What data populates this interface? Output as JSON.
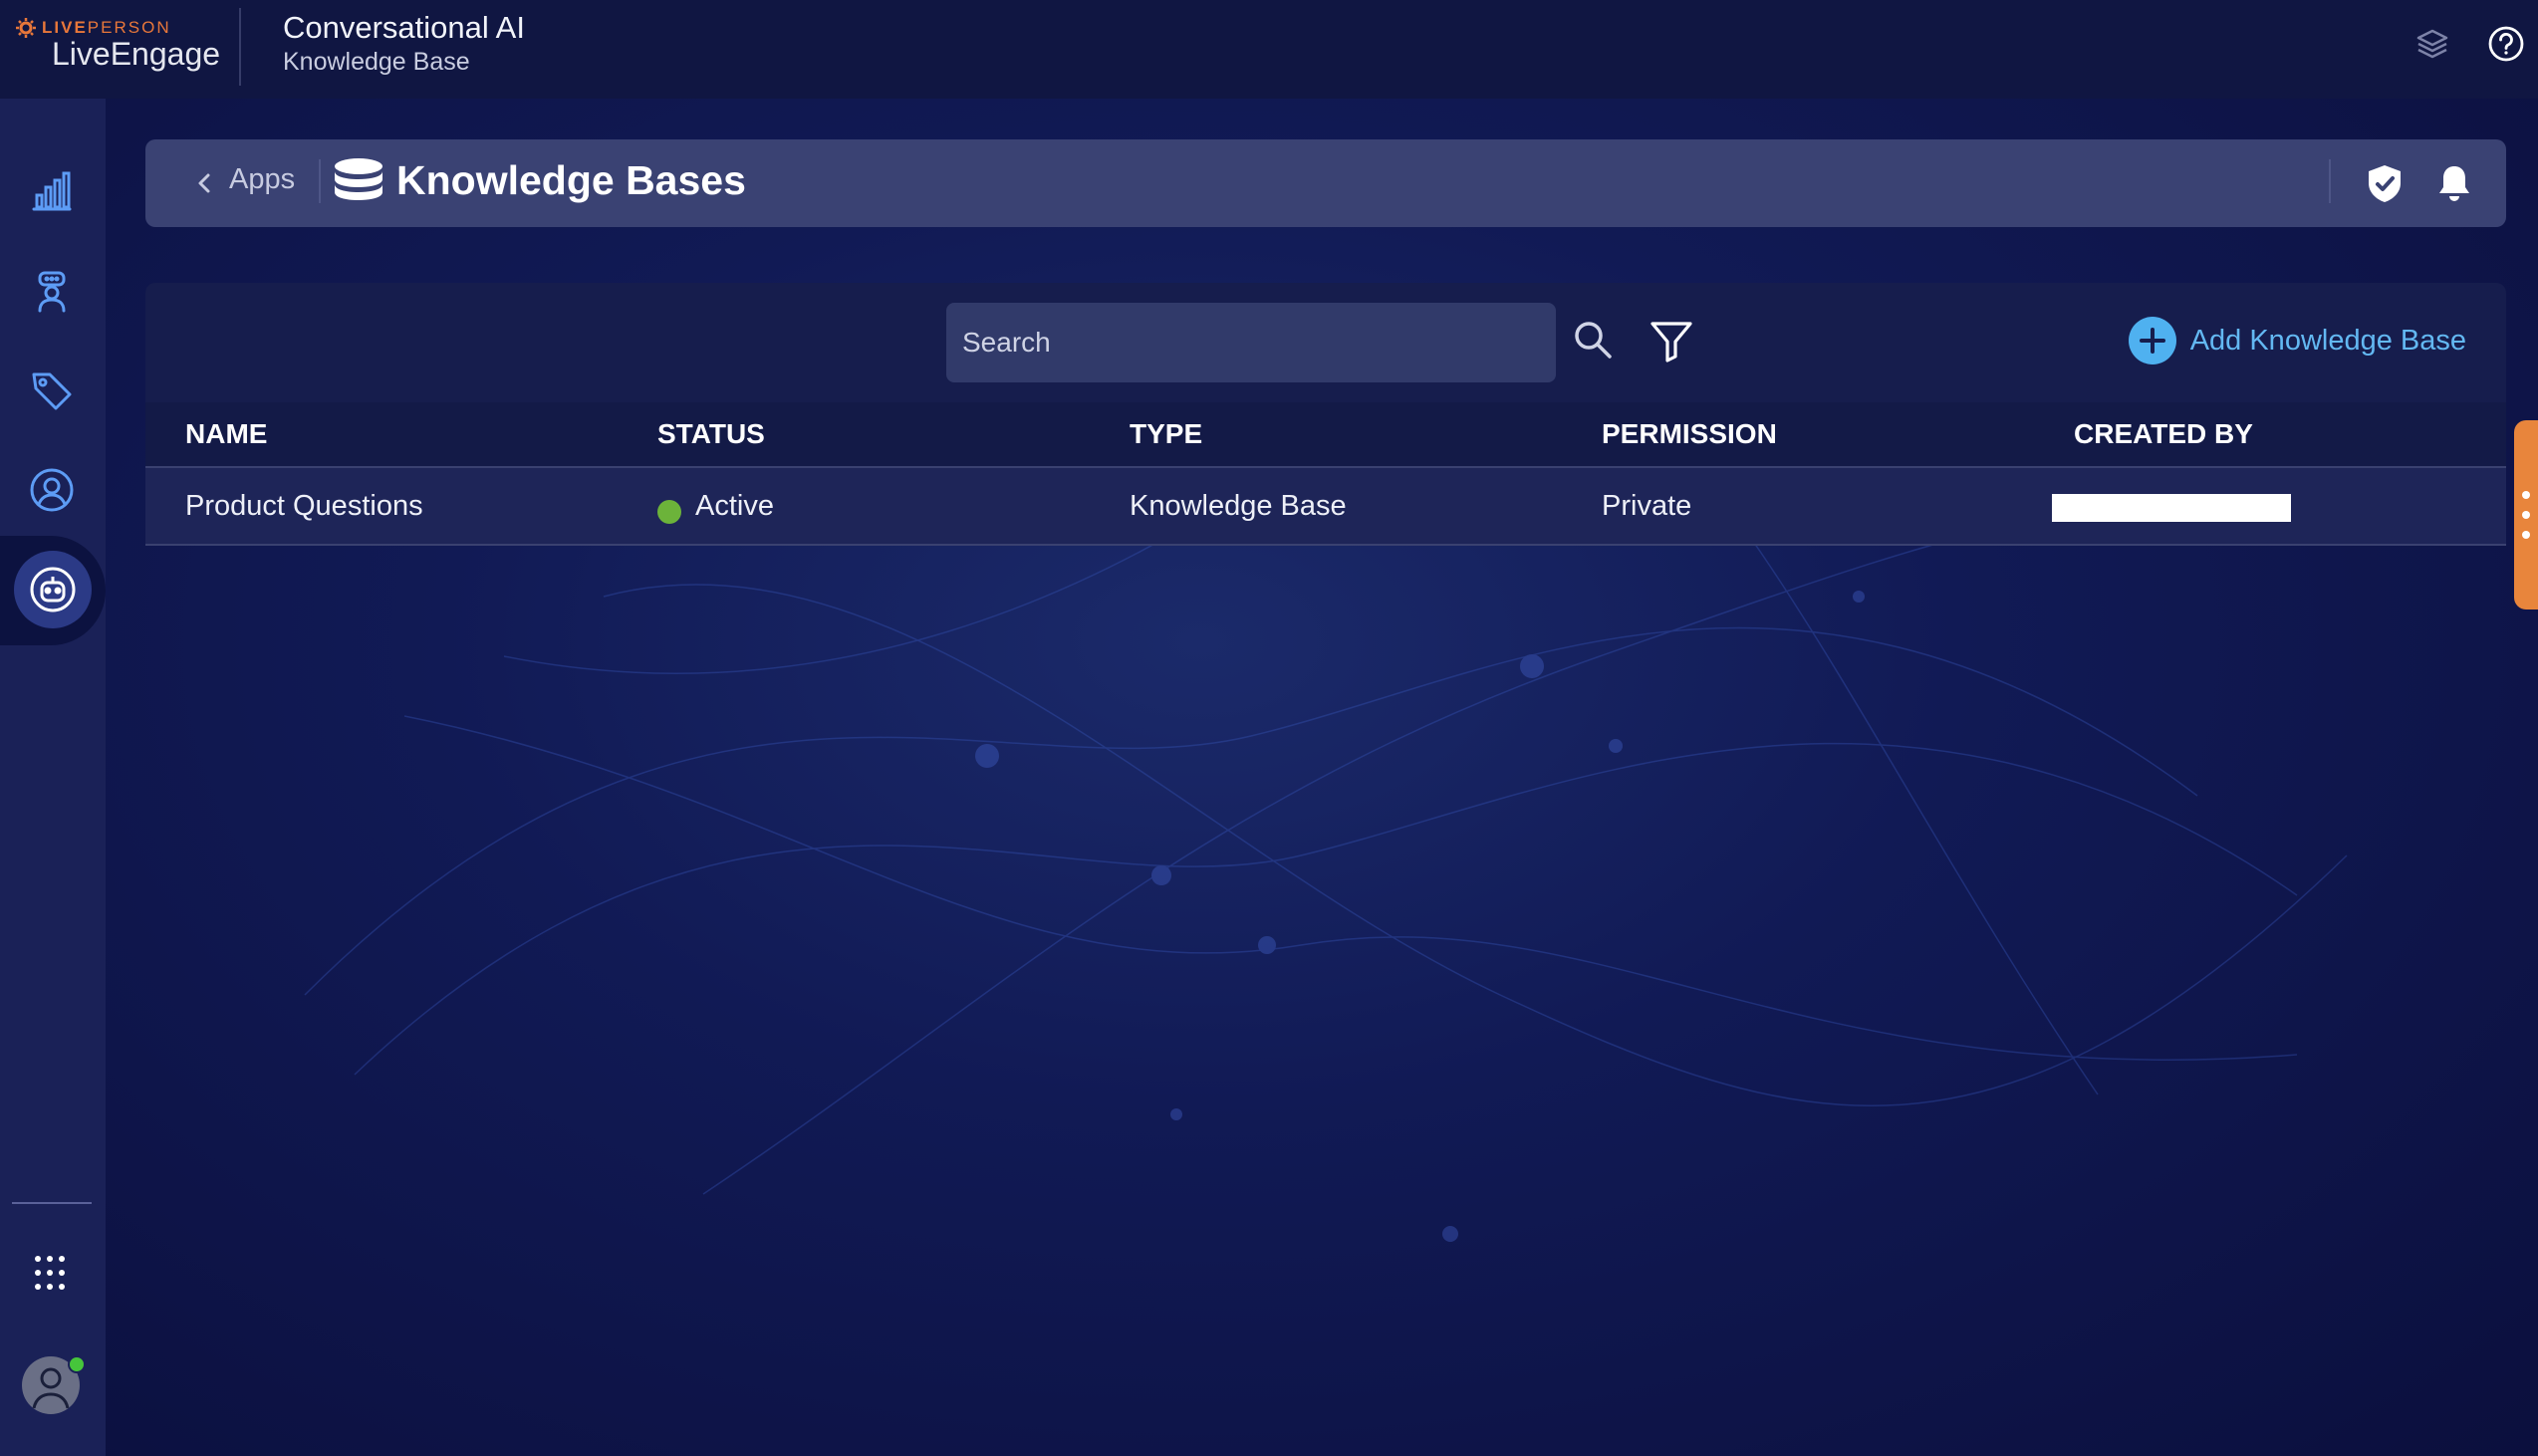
{
  "brand": {
    "super_live": "LIVE",
    "super_person": "PERSON",
    "name": "LiveEngage"
  },
  "app": {
    "title": "Conversational AI",
    "subtitle": "Knowledge Base"
  },
  "header": {
    "back_label": "Apps",
    "title": "Knowledge Bases"
  },
  "toolbar": {
    "search_placeholder": "Search",
    "add_label": "Add Knowledge Base"
  },
  "table": {
    "columns": [
      "NAME",
      "STATUS",
      "TYPE",
      "PERMISSION",
      "CREATED BY"
    ],
    "rows": [
      {
        "name": "Product Questions",
        "status": "Active",
        "type": "Knowledge Base",
        "permission": "Private",
        "created_by": ""
      }
    ]
  },
  "sidebar": {
    "items": [
      "analytics-icon",
      "agent-workspace-icon",
      "tag-icon",
      "user-icon",
      "bot-icon",
      "apps-grid-icon"
    ]
  },
  "colors": {
    "accent": "#4fb1f0",
    "status_active": "#6cb33a",
    "brand_orange": "#e8773a"
  }
}
